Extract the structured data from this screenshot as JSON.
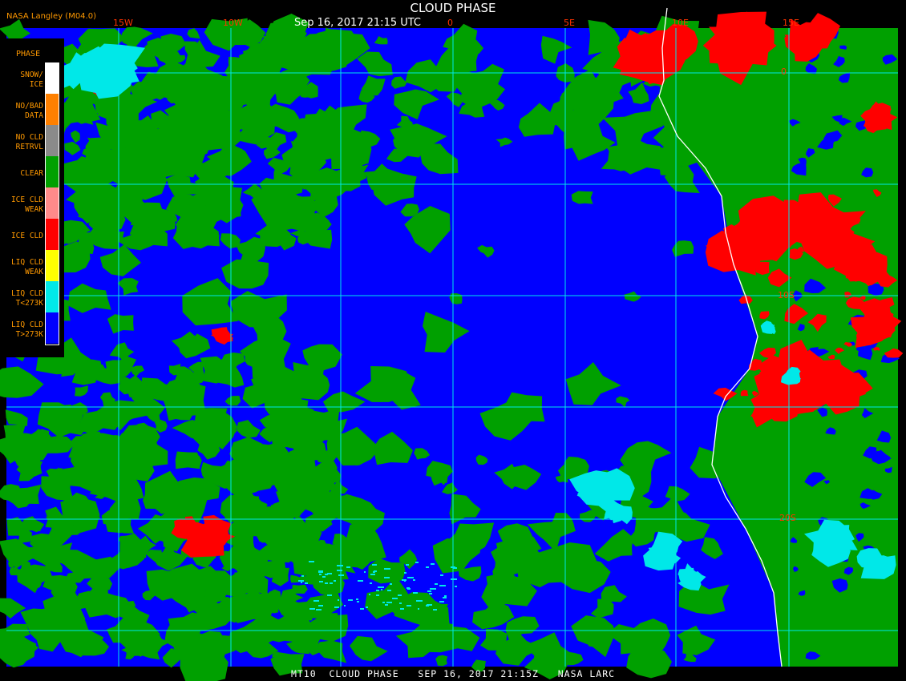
{
  "header": {
    "source": "NASA Langley (M04.0)",
    "title": "CLOUD PHASE",
    "time": "Sep 16, 2017 21:15 UTC"
  },
  "legend": {
    "title": "PHASE",
    "items": [
      {
        "label": "SNOW/\nICE",
        "color": "#ffffff"
      },
      {
        "label": "NO/BAD\nDATA",
        "color": "#ff8000"
      },
      {
        "label": "NO CLD\nRETRVL",
        "color": "#8a8a8a"
      },
      {
        "label": "CLEAR",
        "color": "#00a000"
      },
      {
        "label": "ICE CLD\nWEAK",
        "color": "#ff8a8a"
      },
      {
        "label": "ICE CLD",
        "color": "#ff0000"
      },
      {
        "label": "LIQ CLD\nWEAK",
        "color": "#ffff00"
      },
      {
        "label": "LIQ CLD\nT<273K",
        "color": "#00e8e8"
      },
      {
        "label": "LIQ CLD\nT>273K",
        "color": "#0000ff"
      }
    ]
  },
  "grid": {
    "longitude_labels": [
      "15W",
      "10W",
      "0",
      "5E",
      "10E",
      "15E"
    ],
    "latitude_labels": [
      "0",
      "10S",
      "20S"
    ]
  },
  "footer": {
    "text": "MT10  CLOUD PHASE   SEP 16, 2017 21:15Z   NASA LARC"
  },
  "colors": {
    "ocean_liquid": "#0000ff",
    "clear": "#00a000",
    "ice": "#ff0000",
    "liquid_cold": "#00e8e8",
    "grid": "#00e8e8",
    "coast": "#ffffff"
  }
}
